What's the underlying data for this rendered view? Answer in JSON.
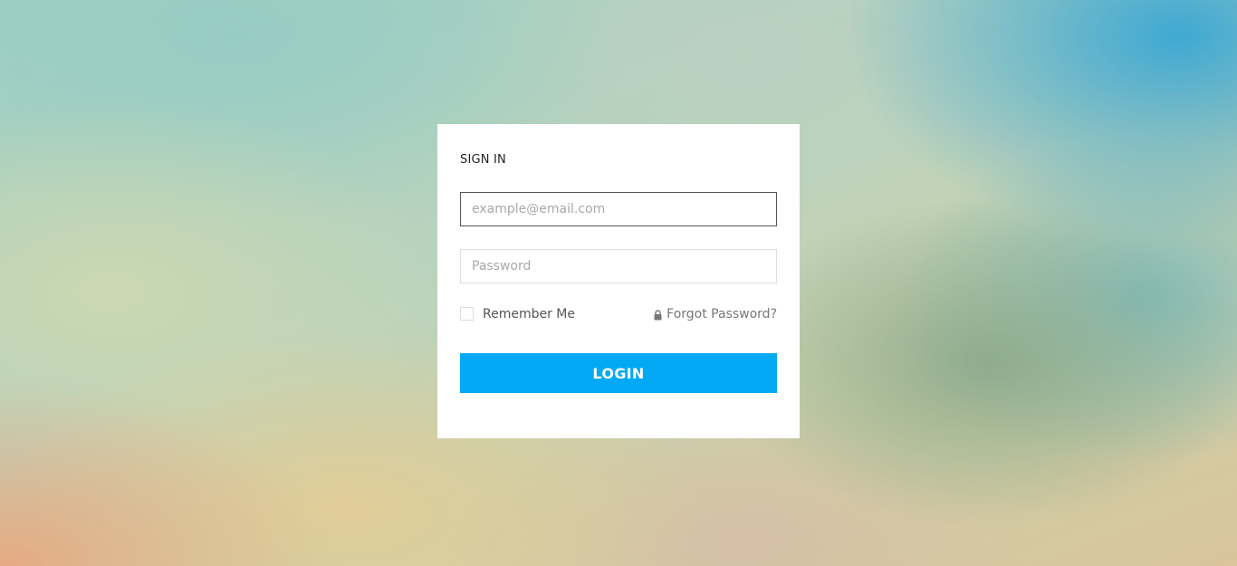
{
  "form": {
    "title": "SIGN IN",
    "email": {
      "value": "",
      "placeholder": "example@email.com"
    },
    "password": {
      "value": "",
      "placeholder": "Password"
    },
    "remember": {
      "label": "Remember Me",
      "checked": false
    },
    "forgot": {
      "label": "Forgot Password?",
      "icon": "lock-icon"
    },
    "login_label": "LOGIN"
  },
  "colors": {
    "accent": "#03a9f4",
    "card_bg": "#ffffff",
    "text": "#555555"
  }
}
